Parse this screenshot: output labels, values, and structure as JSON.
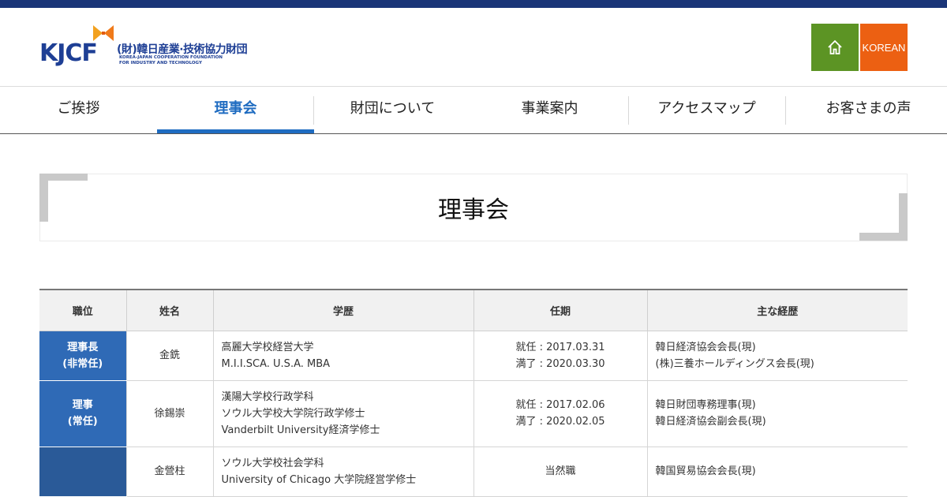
{
  "header": {
    "logo": {
      "mark_text": "KJCF",
      "name_ja": "(財)韓日産業·技術協力財団",
      "name_en_1": "KOREA-JAPAN COOPERATION FOUNDATION",
      "name_en_2": "FOR INDUSTRY AND TECHNOLOGY"
    },
    "home_icon": "home-icon",
    "korean_label": "KOREAN"
  },
  "nav": {
    "items": [
      {
        "label": "ご挨拶"
      },
      {
        "label": "理事会"
      },
      {
        "label": "財団について"
      },
      {
        "label": "事業案内"
      },
      {
        "label": "アクセスマップ"
      },
      {
        "label": "お客さまの声"
      }
    ],
    "active_index": 1
  },
  "page": {
    "title": "理事会"
  },
  "table": {
    "headers": [
      "職位",
      "姓名",
      "学歴",
      "任期",
      "主な経歴"
    ],
    "rows": [
      {
        "position": [
          "理事長",
          "(非常任)"
        ],
        "name": "金銑",
        "education": [
          "高麗大学校経営大学",
          "M.I.I.SCA. U.S.A. MBA"
        ],
        "term": [
          "就任 : 2017.03.31",
          "満了 : 2020.03.30"
        ],
        "career": [
          "韓日経済協会会長(現)",
          "(株)三養ホールディングス会長(現)"
        ]
      },
      {
        "position": [
          "理事",
          "(常任)"
        ],
        "name": "徐錫崇",
        "education": [
          "漢陽大学校行政学科",
          "ソウル大学校大学院行政学修士",
          "Vanderbilt University経済学修士"
        ],
        "term": [
          "就任 : 2017.02.06",
          "満了 : 2020.02.05"
        ],
        "career": [
          "韓日財団専務理事(現)",
          "韓日経済協会副会長(現)"
        ]
      },
      {
        "position": [],
        "name": "金營柱",
        "education": [
          "ソウル大学校社会学科",
          "University of Chicago 大学院経営学修士"
        ],
        "term": [
          "当然職"
        ],
        "career": [
          "韓国貿易協会会長(現)"
        ]
      }
    ]
  },
  "colors": {
    "top_bar": "#1a3578",
    "home_button": "#5c9424",
    "korean_button": "#ec6012",
    "nav_active": "#1f6cc1",
    "position_cell": "#2f6ab6",
    "header_row": "#f1f1f1"
  }
}
